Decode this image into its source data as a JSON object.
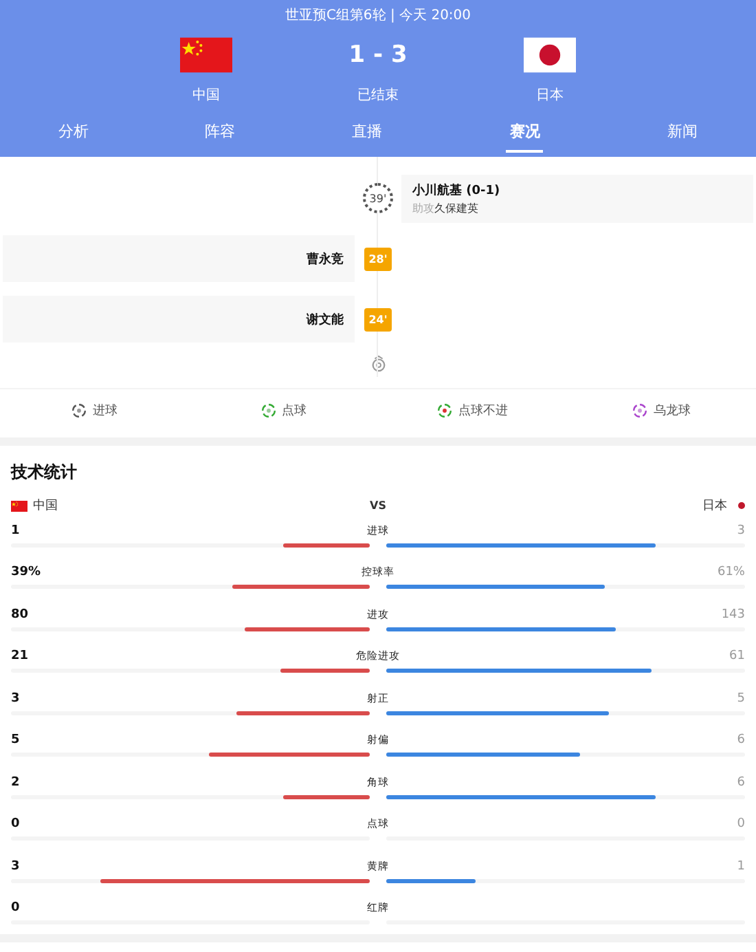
{
  "header": {
    "title": "世亚预C组第6轮 | 今天 20:00",
    "home": {
      "name": "中国"
    },
    "away": {
      "name": "日本"
    },
    "score": "1 - 3",
    "status": "已结束"
  },
  "tabs": [
    {
      "label": "分析",
      "selected": false
    },
    {
      "label": "阵容",
      "selected": false
    },
    {
      "label": "直播",
      "selected": false
    },
    {
      "label": "赛况",
      "selected": true
    },
    {
      "label": "新闻",
      "selected": false
    }
  ],
  "timeline": [
    {
      "kind": "away_goal",
      "minute": "39'",
      "player": "小川航基 (0-1)",
      "assist_label": "助攻",
      "assist": "久保建英"
    },
    {
      "kind": "home_booking",
      "minute": "28'",
      "player": "曹永竞"
    },
    {
      "kind": "home_booking",
      "minute": "24'",
      "player": "谢文能"
    }
  ],
  "legend": [
    {
      "kind": "goal",
      "label": "进球"
    },
    {
      "kind": "penalty",
      "label": "点球"
    },
    {
      "kind": "missed_penalty",
      "label": "点球不进"
    },
    {
      "kind": "own_goal",
      "label": "乌龙球"
    }
  ],
  "stats": {
    "title": "技术统计",
    "home": "中国",
    "vs": "VS",
    "away": "日本",
    "rows": [
      {
        "label": "进球",
        "home": {
          "value": "1",
          "level": 0.24
        },
        "away": {
          "value": "3",
          "level": 0.75
        }
      },
      {
        "label": "控球率",
        "home": {
          "value": "39%",
          "level": 0.385
        },
        "away": {
          "value": "61%",
          "level": 0.61
        }
      },
      {
        "label": "进攻",
        "home": {
          "value": "80",
          "level": 0.35
        },
        "away": {
          "value": "143",
          "level": 0.64
        }
      },
      {
        "label": "危险进攻",
        "home": {
          "value": "21",
          "level": 0.25
        },
        "away": {
          "value": "61",
          "level": 0.74
        }
      },
      {
        "label": "射正",
        "home": {
          "value": "3",
          "level": 0.37
        },
        "away": {
          "value": "5",
          "level": 0.62
        }
      },
      {
        "label": "射偏",
        "home": {
          "value": "5",
          "level": 0.45
        },
        "away": {
          "value": "6",
          "level": 0.54
        }
      },
      {
        "label": "角球",
        "home": {
          "value": "2",
          "level": 0.24
        },
        "away": {
          "value": "6",
          "level": 0.75
        }
      },
      {
        "label": "点球",
        "home": {
          "value": "0"
        },
        "away": {
          "value": "0"
        }
      },
      {
        "label": "黄牌",
        "home": {
          "value": "3",
          "level": 0.75
        },
        "away": {
          "value": "1",
          "level": 0.25
        }
      },
      {
        "label": "红牌",
        "home": {
          "value": "0"
        },
        "away": {}
      }
    ]
  }
}
